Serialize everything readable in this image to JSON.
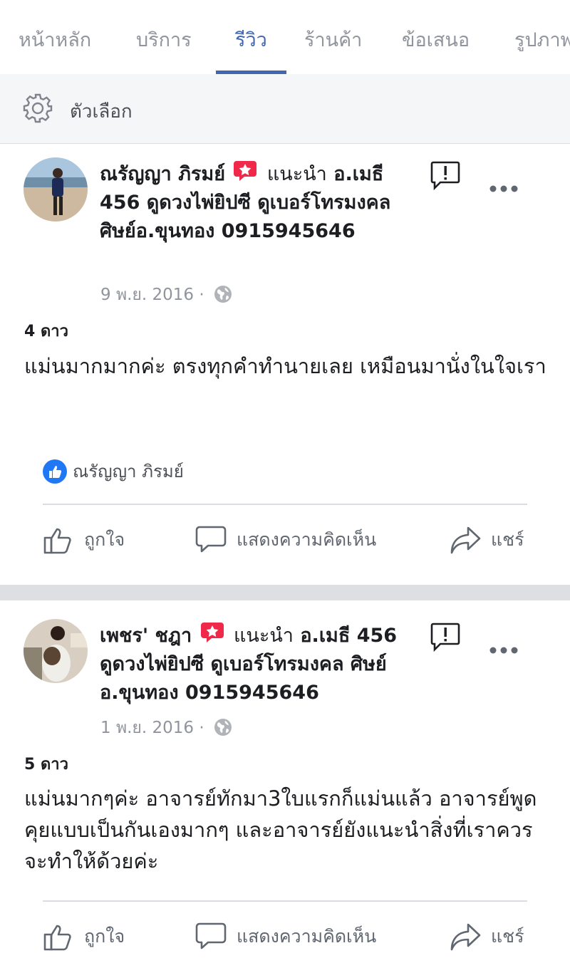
{
  "tabs": [
    {
      "label": "หน้าหลัก"
    },
    {
      "label": "บริการ"
    },
    {
      "label": "รีวิว"
    },
    {
      "label": "ร้านค้า"
    },
    {
      "label": "ข้อเสนอ"
    },
    {
      "label": "รูปภาพ"
    }
  ],
  "active_tab": "รีวิว",
  "options": {
    "label": "ตัวเลือก"
  },
  "colors": {
    "accent": "#4267b2",
    "badge": "#f02849",
    "muted": "#90949c",
    "separator": "#dddfe2"
  },
  "icons": {
    "options": "gear-icon",
    "recommend": "recommend-badge-icon",
    "report": "report-icon",
    "more": "more-icon",
    "privacy": "globe-icon",
    "like": "thumbs-up-icon",
    "comment": "comment-icon",
    "share": "share-icon"
  },
  "posts": [
    {
      "author": "ณรัญญา ภิรมย์",
      "recommends": "แนะนำ",
      "page_name": "อ.เมธี 456 ดูดวงไพ่ยิปซี ดูเบอร์โทรมงคล ศิษย์อ.ขุนทอง 0915945646",
      "date": "9 พ.ย. 2016 ·",
      "stars": "4 ดาว",
      "text": "แม่นมากมากค่ะ ตรงทุกคำทำนายเลย เหมือนมานั่งในใจเรา",
      "liker": "ณรัญญา ภิรมย์",
      "actions": {
        "like": "ถูกใจ",
        "comment": "แสดงความคิดเห็น",
        "share": "แชร์"
      }
    },
    {
      "author": "เพชร' ชฎา",
      "recommends": "แนะนำ",
      "page_name": "อ.เมธี 456 ดูดวงไพ่ยิปซี ดูเบอร์โทรมงคล ศิษย์อ.ขุนทอง 0915945646",
      "date": "1 พ.ย. 2016 ·",
      "stars": "5 ดาว",
      "text": "แม่นมากๆค่ะ อาจารย์ทักมา3ใบแรกก็แม่นแล้ว อาจารย์พูดคุยแบบเป็นกันเองมากๆ และอาจารย์ยังแนะนำสิ่งที่เราควรจะทำให้ด้วยค่ะ",
      "actions": {
        "like": "ถูกใจ",
        "comment": "แสดงความคิดเห็น",
        "share": "แชร์"
      }
    }
  ]
}
